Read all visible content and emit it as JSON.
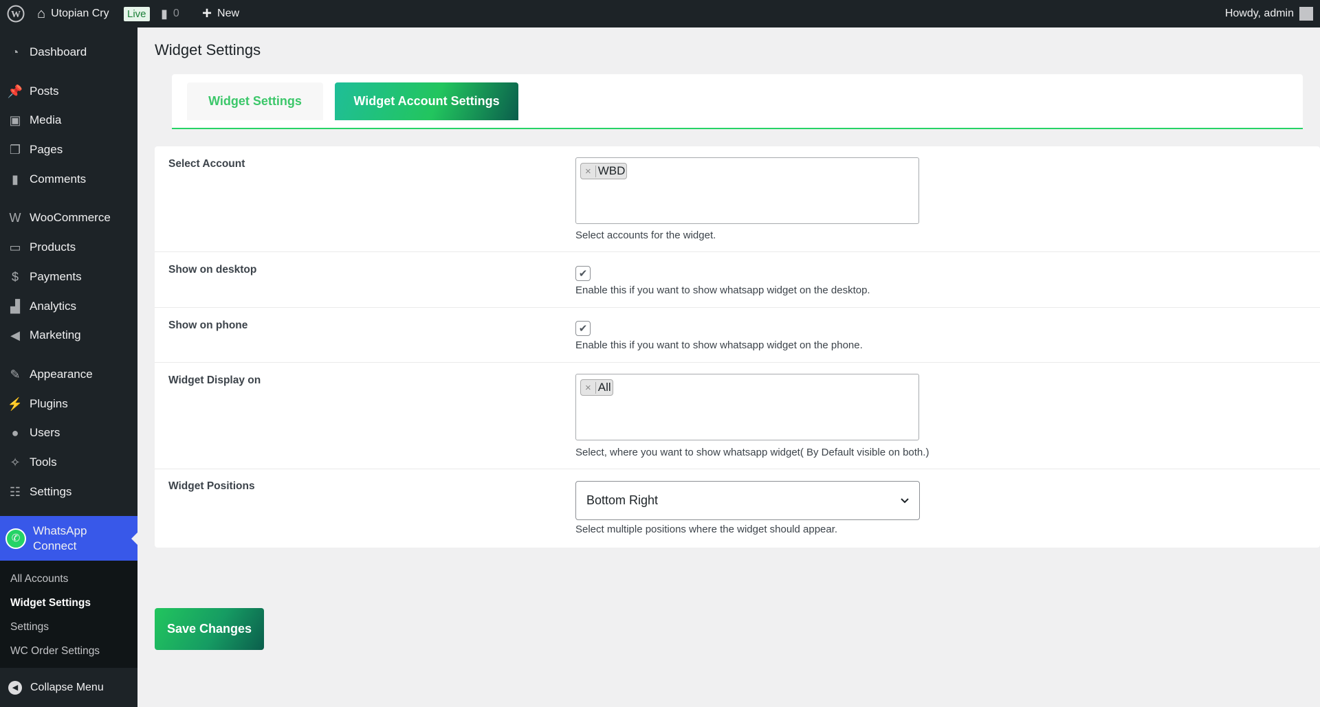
{
  "adminbar": {
    "site": "Utopian Cry",
    "live": "Live",
    "comments": "0",
    "new": "New",
    "howdy": "Howdy, admin"
  },
  "sidebar": {
    "items": [
      {
        "label": "Dashboard",
        "icon": "dashboard-icon"
      },
      {
        "label": "Posts",
        "icon": "pin-icon"
      },
      {
        "label": "Media",
        "icon": "media-icon"
      },
      {
        "label": "Pages",
        "icon": "pages-icon"
      },
      {
        "label": "Comments",
        "icon": "comment-icon"
      },
      {
        "label": "WooCommerce",
        "icon": "woo-icon"
      },
      {
        "label": "Products",
        "icon": "archive-icon"
      },
      {
        "label": "Payments",
        "icon": "dollar-icon"
      },
      {
        "label": "Analytics",
        "icon": "bar-chart-icon"
      },
      {
        "label": "Marketing",
        "icon": "megaphone-icon"
      },
      {
        "label": "Appearance",
        "icon": "brush-icon"
      },
      {
        "label": "Plugins",
        "icon": "plug-icon"
      },
      {
        "label": "Users",
        "icon": "user-icon"
      },
      {
        "label": "Tools",
        "icon": "wrench-icon"
      },
      {
        "label": "Settings",
        "icon": "sliders-icon"
      }
    ],
    "active": {
      "line1": "WhatsApp",
      "line2": "Connect"
    },
    "submenu": [
      "All Accounts",
      "Widget Settings",
      "Settings",
      "WC Order Settings"
    ],
    "collapse": "Collapse Menu"
  },
  "page": {
    "title": "Widget Settings",
    "tabs": [
      "Widget Settings",
      "Widget Account Settings"
    ]
  },
  "form": {
    "select_account": {
      "label": "Select Account",
      "chip": "WBD",
      "help": "Select accounts for the widget."
    },
    "desktop": {
      "label": "Show on desktop",
      "checked": true,
      "help": "Enable this if you want to show whatsapp widget on the desktop."
    },
    "phone": {
      "label": "Show on phone",
      "checked": true,
      "help": "Enable this if you want to show whatsapp widget on the phone."
    },
    "display": {
      "label": "Widget Display on",
      "chip": "All",
      "help": "Select, where you want to show whatsapp widget( By Default visible on both.)"
    },
    "positions": {
      "label": "Widget Positions",
      "value": "Bottom Right",
      "help": "Select multiple positions where the widget should appear."
    }
  },
  "save": "Save Changes",
  "colors": {
    "accent": "#25d366",
    "menu_active": "#3858e9"
  }
}
